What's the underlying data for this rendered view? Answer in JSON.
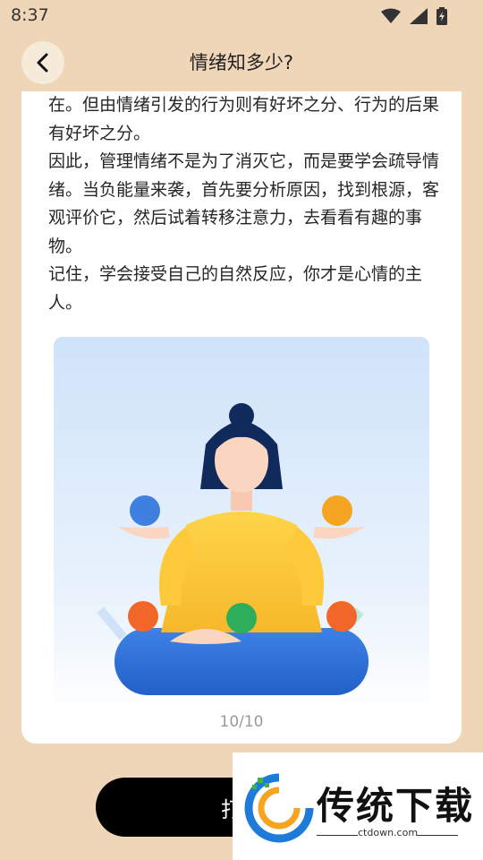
{
  "status_bar": {
    "time": "8:37"
  },
  "header": {
    "title": "情绪知多少?"
  },
  "article": {
    "paragraphs": [
      "在。但由情绪引发的行为则有好坏之分、行为的后果有好坏之分。",
      "因此，管理情绪不是为了消灭它，而是要学会疏导情绪。当负能量来袭，首先要分析原因，找到根源，客观评价它，然后试着转移注意力，去看看有趣的事物。",
      "记住，学会接受自己的自然反应，你才是心情的主人。"
    ]
  },
  "page_indicator": "10/10",
  "bottom_button": {
    "label": "打"
  },
  "watermark": {
    "brand": "传统下载",
    "url": "ctdown.com"
  },
  "colors": {
    "background": "#EFD6B8",
    "card": "#FFFFFF",
    "button": "#000000"
  }
}
